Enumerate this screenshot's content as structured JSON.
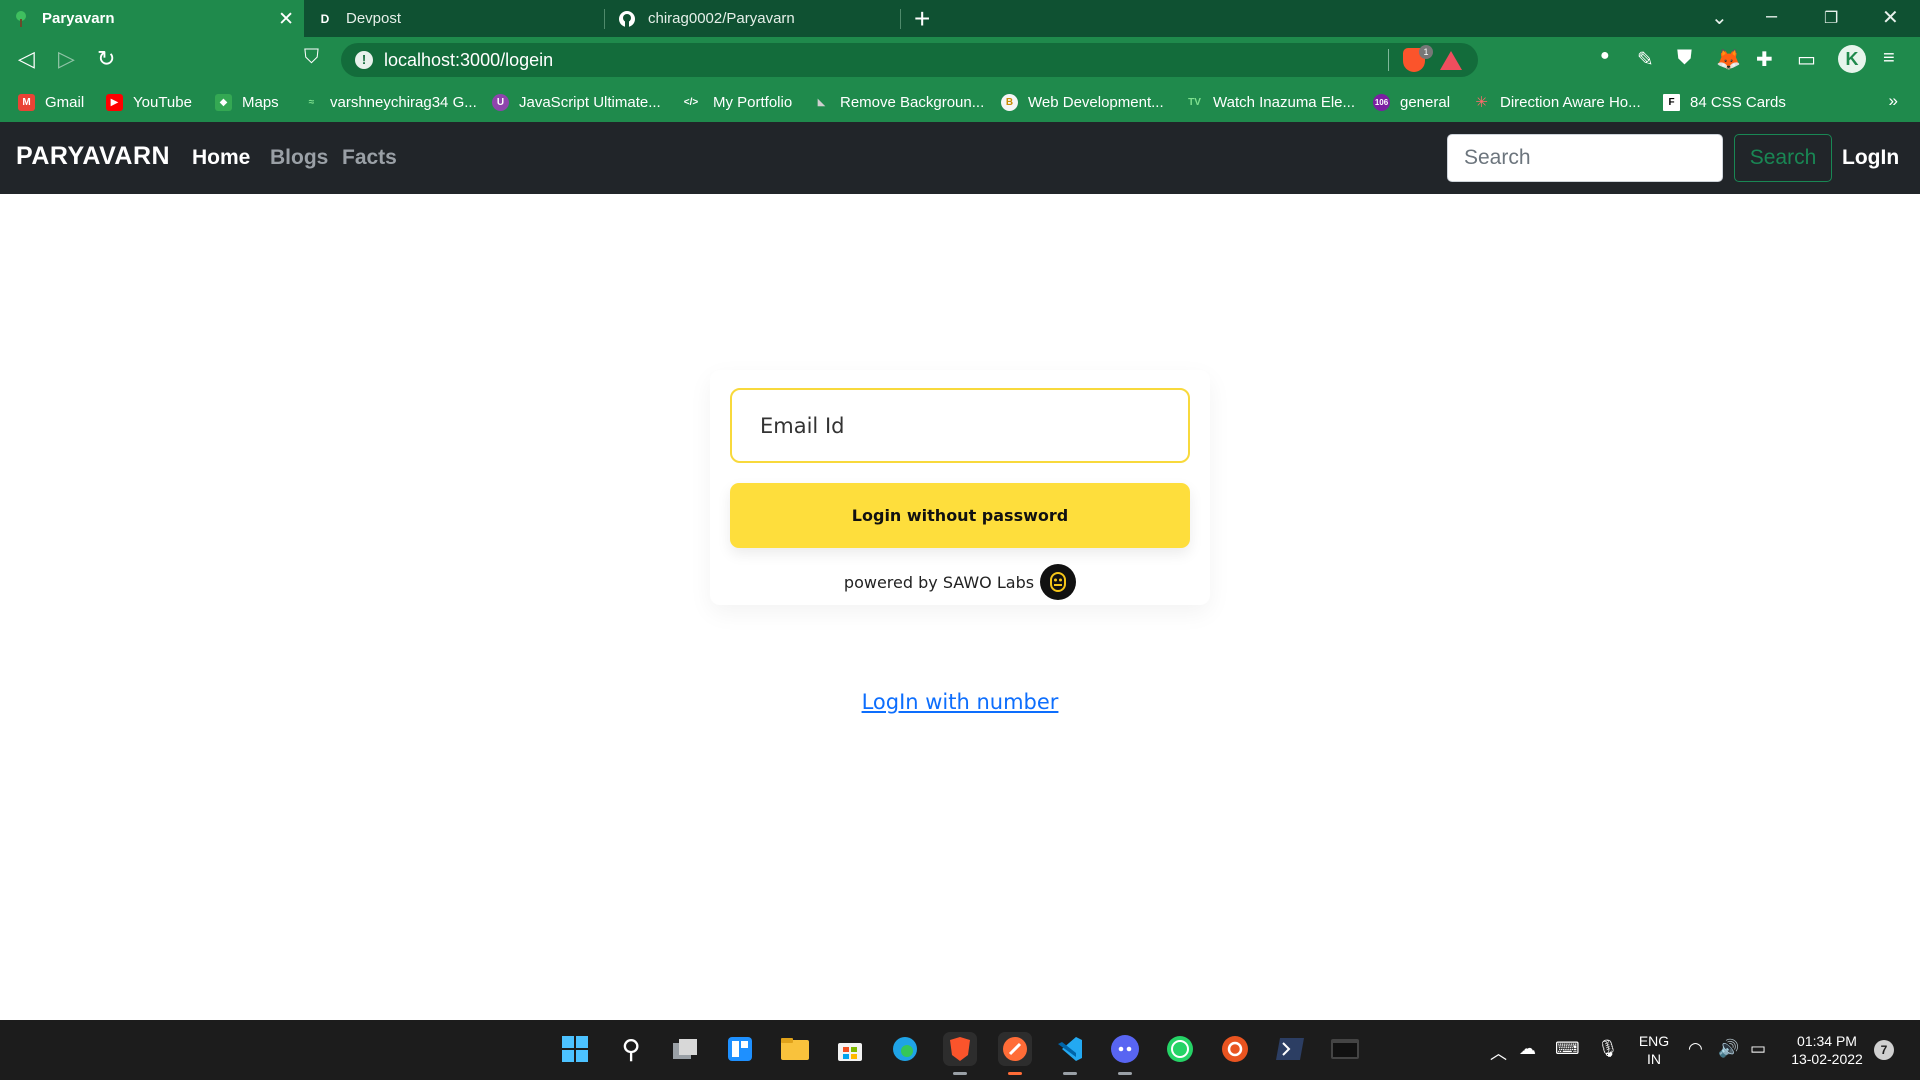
{
  "browser": {
    "tabs": [
      {
        "title": "Paryavarn",
        "favicon": "tree-icon",
        "active": true
      },
      {
        "title": "Devpost",
        "favicon_text": "D"
      },
      {
        "title": "chirag0002/Paryavarn",
        "favicon": "github-icon"
      }
    ],
    "url": "localhost:3000/logein",
    "brave_badge": "1",
    "bookmarks": [
      {
        "label": "Gmail",
        "color": "#ea4335",
        "glyph": "M"
      },
      {
        "label": "YouTube",
        "color": "#ff0000",
        "glyph": "▶"
      },
      {
        "label": "Maps",
        "color": "#34a853",
        "glyph": "◆"
      },
      {
        "label": "varshneychirag34 G...",
        "color": "#3fa34d",
        "glyph": "≈"
      },
      {
        "label": "JavaScript Ultimate...",
        "color": "#8e44ad",
        "glyph": "U"
      },
      {
        "label": "My Portfolio",
        "color": "#1f8a4c",
        "glyph": "</>"
      },
      {
        "label": "Remove Backgroun...",
        "color": "#9e9e9e",
        "glyph": "◣"
      },
      {
        "label": "Web Development...",
        "color": "#f5f5f5",
        "glyph": "B"
      },
      {
        "label": "Watch Inazuma Ele...",
        "color": "#2e7d32",
        "glyph": "TV"
      },
      {
        "label": "general",
        "color": "#7b1fa2",
        "glyph": "106"
      },
      {
        "label": "Direction Aware Ho...",
        "color": "#e53935",
        "glyph": "✳"
      },
      {
        "label": "84 CSS Cards",
        "color": "#000000",
        "glyph": "F"
      }
    ]
  },
  "site": {
    "brand": "PARYAVARN",
    "nav": [
      "Home",
      "Blogs",
      "Facts"
    ],
    "search_placeholder": "Search",
    "search_button": "Search",
    "login_link": "LogIn"
  },
  "login": {
    "email_placeholder": "Email Id",
    "button_label": "Login without password",
    "powered_by": "powered by SAWO Labs",
    "alt_link": "LogIn with number"
  },
  "taskbar": {
    "language_line1": "ENG",
    "language_line2": "IN",
    "time": "01:34 PM",
    "date": "13-02-2022",
    "notifications": "7"
  },
  "colors": {
    "chrome_green": "#1f8a4c",
    "navbar_dark": "#212529",
    "sawo_yellow": "#fede3c",
    "link_blue": "#0d6efd"
  }
}
